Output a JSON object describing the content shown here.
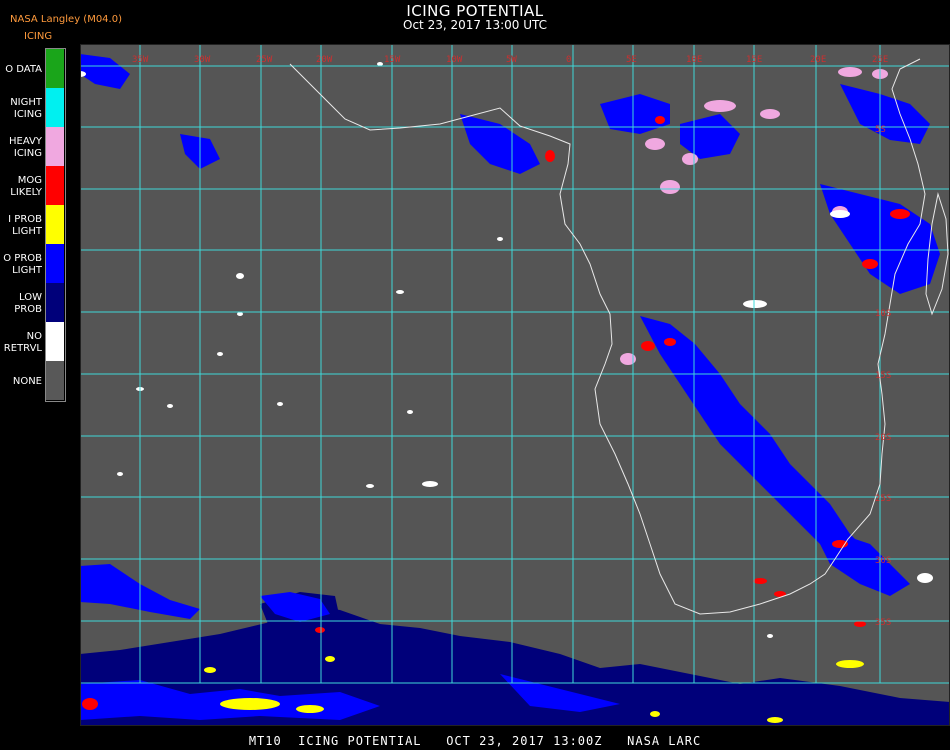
{
  "header": {
    "credit": "NASA Langley (M04.0)",
    "product": "ICING",
    "title": "ICING POTENTIAL",
    "time": "Oct 23, 2017 13:00 UTC"
  },
  "legend": {
    "items": [
      {
        "label": "O DATA",
        "color": "#1aa51a"
      },
      {
        "label": "NIGHT\nICING",
        "color": "#00f0f0"
      },
      {
        "label": "HEAVY\nICING",
        "color": "#f0a8e0"
      },
      {
        "label": "MOG\nLIKELY",
        "color": "#ff0000"
      },
      {
        "label": "I PROB\nLIGHT",
        "color": "#ffff00"
      },
      {
        "label": "O PROB\nLIGHT",
        "color": "#0000ff"
      },
      {
        "label": "LOW\nPROB",
        "color": "#00007a"
      },
      {
        "label": "NO\nRETRVL",
        "color": "#ffffff"
      },
      {
        "label": "NONE",
        "color": "#585858"
      }
    ]
  },
  "map": {
    "background_color": "#555555",
    "grid_color": "#3fd8d8",
    "coastline_color": "#e8e8e8",
    "label_color": "#cc3030"
  },
  "footer": {
    "text": "MT10  ICING POTENTIAL   OCT 23, 2017 13:00Z   NASA LARC"
  }
}
